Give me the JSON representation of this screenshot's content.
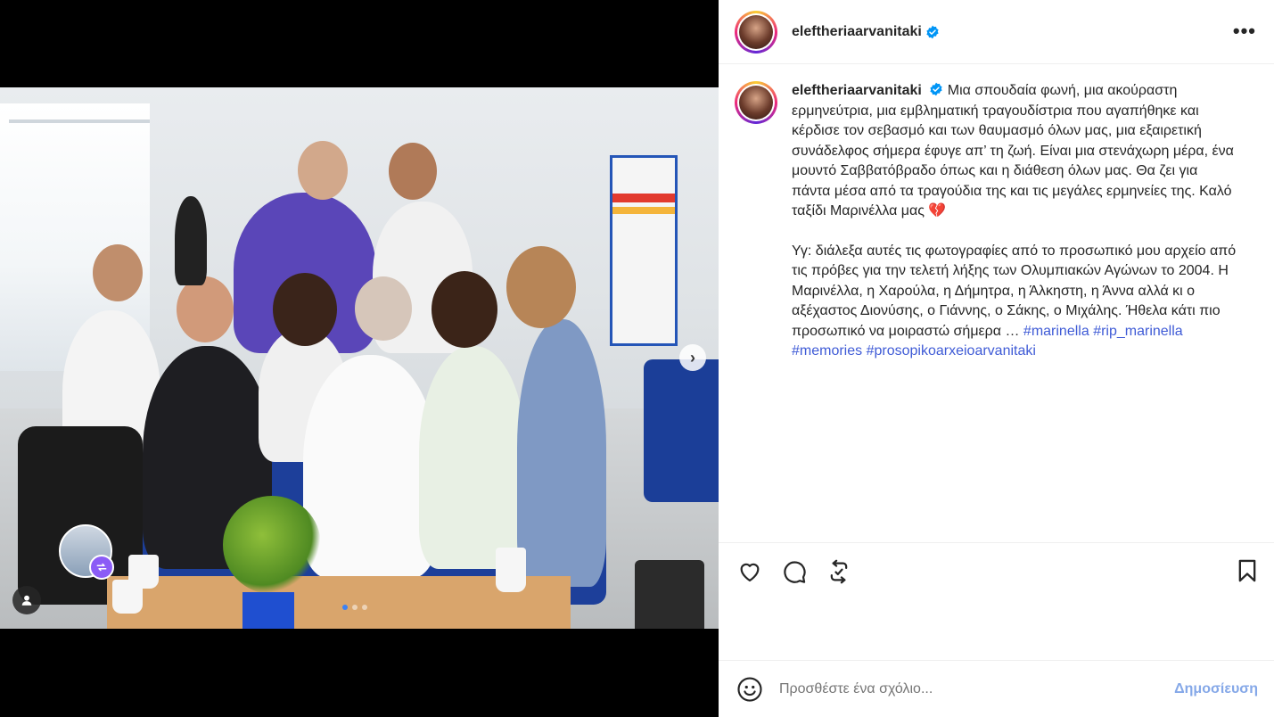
{
  "post": {
    "username": "eleftheriaarvanitaki",
    "more_label": "•••"
  },
  "caption": {
    "username": "eleftheriaarvanitaki",
    "paragraph1": "Μια σπουδαία φωνή, μια ακούραστη ερμηνεύτρια, μια εμβληματική τραγουδίστρια που αγαπήθηκε και κέρδισε τον σεβασμό και των θαυμασμό όλων μας, μια εξαιρετική συνάδελφος σήμερα έφυγε απ’ τη ζωή. Είναι μια στενάχωρη μέρα, ένα μουντό Σαββατόβραδο όπως και η διάθεση όλων μας. Θα ζει για πάντα μέσα από τα τραγούδια της και τις μεγάλες ερμηνείες της. Καλό ταξίδι Μαρινέλλα μας",
    "emoji": "💔",
    "paragraph2": "Υγ: διάλεξα αυτές τις φωτογραφίες από το προσωπικό μου αρχείο από τις πρόβες για την τελετή λήξης των Ολυμπιακών Αγώνων το 2004. Η Μαρινέλλα, η Χαρούλα, η Δήμητρα, η Άλκηστη, η Άννα αλλά κι ο αξέχαστος Διονύσης, ο Γιάννης, ο Σάκης, ο Μιχάλης. Ήθελα κάτι πιο προσωπικό να μοιραστώ σήμερα …",
    "hashtags_inline": [
      "#marinella",
      "#rip_marinella",
      "#memories"
    ],
    "hashtag_last": "#prosopikoarxeioarvanitaki"
  },
  "carousel": {
    "total_slides": 3,
    "active_slide": 1,
    "next_label": "›"
  },
  "comment": {
    "placeholder": "Προσθέστε ένα σχόλιο...",
    "post_label": "Δημοσίευση"
  },
  "colors": {
    "accent": "#3f5bd6",
    "post_button": "#85a8e8",
    "verified": "#0095f6"
  },
  "icons": [
    "like-icon",
    "comment-icon",
    "repost-icon",
    "bookmark-icon",
    "emoji-icon",
    "tag-user-icon",
    "more-icon",
    "verified-icon",
    "next-arrow-icon"
  ]
}
